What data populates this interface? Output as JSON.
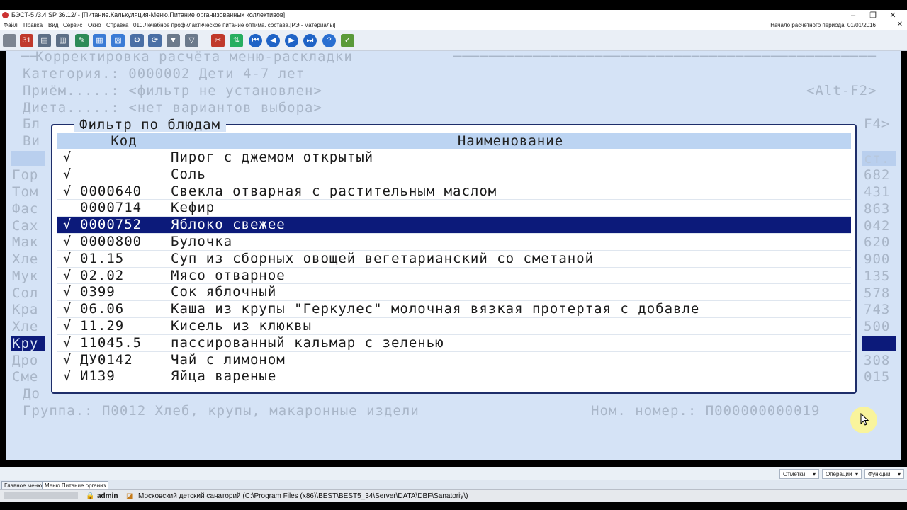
{
  "window": {
    "title": "БЭСТ-5 /3.4 SP 36.12/ - [Питание.Калькуляция-Меню.Питание организованных коллективов]"
  },
  "menu": {
    "items": [
      "Файл",
      "Правка",
      "Вид",
      "Сервис",
      "Окно",
      "Справка",
      "010.Лечебное профилактическое питание оптима. состава.[РЭ - материалы]"
    ],
    "period_label": "Начало расчетного периода: 01/01/2016"
  },
  "dos": {
    "header": "Корректировка расчёта меню-раскладки",
    "category_line": "Категория.: 0000002 Дети 4-7 лет",
    "meal_line": "Приём.....: <фильтр не установлен>",
    "meal_hotkey": "<Alt-F2>",
    "diet_line": "Диета.....: <нет вариантов выбора>",
    "bl_left": "Бл",
    "f4_hotkey": "F4>",
    "vi_left": "Ви",
    "col_right_header": "ст.",
    "left_partial": [
      "Гор",
      "Том",
      "Фас",
      "Сах",
      "Мак",
      "Хле",
      "Мук",
      "Сол",
      "Кра",
      "Хле",
      "Кру",
      "Дро",
      "Сме"
    ],
    "right_partial": [
      "682",
      "431",
      "863",
      "042",
      "620",
      "900",
      "135",
      "578",
      "743",
      "500",
      "",
      "308",
      "015"
    ],
    "do_left": "До",
    "group_line": "Группа.: П0012 Хлеб, крупы, макаронные издели",
    "nom_line": "Ном. номер.: П000000000019"
  },
  "popup": {
    "title": "Фильтр по блюдам",
    "columns": {
      "code": "Код",
      "name": "Наименование"
    },
    "rows": [
      {
        "check": "√",
        "code": "",
        "name": "Пирог с джемом открытый"
      },
      {
        "check": "√",
        "code": "",
        "name": "Соль"
      },
      {
        "check": "√",
        "code": "0000640",
        "name": "Свекла отварная с растительным маслом"
      },
      {
        "check": "",
        "code": "0000714",
        "name": "Кефир"
      },
      {
        "check": "√",
        "code": "0000752",
        "name": "Яблоко свежее"
      },
      {
        "check": "√",
        "code": "0000800",
        "name": "Булочка"
      },
      {
        "check": "√",
        "code": "01.15",
        "name": "Суп из сборных овощей вегетарианский со сметаной"
      },
      {
        "check": "√",
        "code": "02.02",
        "name": "Мясо отварное"
      },
      {
        "check": "√",
        "code": "0399",
        "name": "Сок яблочный"
      },
      {
        "check": "√",
        "code": "06.06",
        "name": "Каша из крупы \"Геркулес\" молочная вязкая протертая с добавле"
      },
      {
        "check": "√",
        "code": "11.29",
        "name": "Кисель из клюквы"
      },
      {
        "check": "√",
        "code": "11045.5",
        "name": "пассированный кальмар с зеленью"
      },
      {
        "check": "√",
        "code": "ДУ0142",
        "name": "Чай с лимоном"
      },
      {
        "check": "√",
        "code": "И139",
        "name": "Яйца вареные"
      }
    ]
  },
  "bottom_buttons": [
    "Отметки",
    "Операции",
    "Функции"
  ],
  "tabs": [
    "Главное меню",
    "Меню.Питание организ"
  ],
  "status": {
    "user": "admin",
    "path": "Московский детский санаторий (C:\\Program Files (x86)\\BEST\\BEST5_34\\Server\\DATA\\DBF\\Sanatoriy\\)"
  },
  "colors": {
    "selection": "#0c1a7a",
    "background": "#d5e3f6",
    "header": "#bcd4f2"
  }
}
